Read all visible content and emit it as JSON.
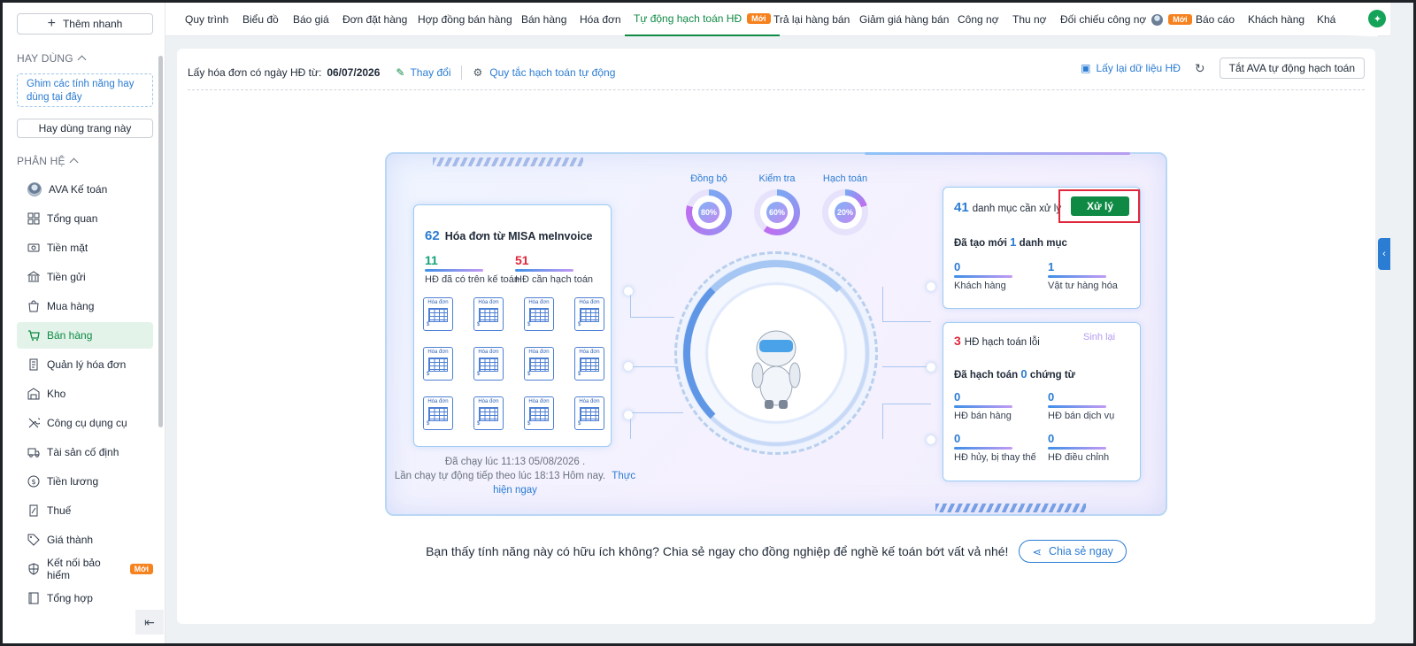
{
  "sidebar": {
    "quick_add": "Thêm nhanh",
    "frequent_title": "HAY DÙNG",
    "pin_hint": "Ghim các tính năng hay dùng tại đây",
    "use_page_button": "Hay dùng trang này",
    "modules_title": "PHÂN HỆ",
    "new_badge": "Mới",
    "items": [
      {
        "label": "AVA Kế toán",
        "icon": "avatar-icon"
      },
      {
        "label": "Tổng quan",
        "icon": "dashboard-icon"
      },
      {
        "label": "Tiền mặt",
        "icon": "cash-icon"
      },
      {
        "label": "Tiền gửi",
        "icon": "bank-icon"
      },
      {
        "label": "Mua hàng",
        "icon": "shopping-bag-icon"
      },
      {
        "label": "Bán hàng",
        "icon": "cart-icon"
      },
      {
        "label": "Quản lý hóa đơn",
        "icon": "invoice-icon"
      },
      {
        "label": "Kho",
        "icon": "warehouse-icon"
      },
      {
        "label": "Công cụ dụng cụ",
        "icon": "tools-icon"
      },
      {
        "label": "Tài sản cố định",
        "icon": "truck-icon"
      },
      {
        "label": "Tiền lương",
        "icon": "dollar-icon"
      },
      {
        "label": "Thuế",
        "icon": "tax-icon"
      },
      {
        "label": "Giá thành",
        "icon": "tag-icon"
      },
      {
        "label": "Kết nối bảo hiểm",
        "icon": "shield-icon"
      },
      {
        "label": "Tổng hợp",
        "icon": "book-icon"
      }
    ]
  },
  "topnav": {
    "tabs": [
      "Quy trình",
      "Biểu đồ",
      "Báo giá",
      "Đơn đặt hàng",
      "Hợp đồng bán hàng",
      "Bán hàng",
      "Hóa đơn",
      "Tự động hạch toán HĐ",
      "Trả lại hàng bán",
      "Giảm giá hàng bán",
      "Công nợ",
      "Thu nợ",
      "Đối chiếu công nợ",
      "Báo cáo",
      "Khách hàng",
      "Khá"
    ],
    "new_badge": "Mới"
  },
  "toolbar": {
    "date_label": "Lấy hóa đơn có ngày HĐ từ:",
    "date_value": "06/07/2026",
    "change": "Thay đổi",
    "rules": "Quy tắc hạch toán tự động",
    "reload": "Lấy lại dữ liệu HĐ",
    "stop_ava": "Tắt AVA tự động hạch toán"
  },
  "hero": {
    "left": {
      "count": "62",
      "title": "Hóa đơn từ MISA meInvoice",
      "posted_count": "11",
      "posted_label": "HĐ đã có trên kế toán",
      "pending_count": "51",
      "pending_label": "HĐ cần hạch toán",
      "invoice_tile_label": "Hóa đơn"
    },
    "rings": [
      {
        "label": "Đồng bộ",
        "percent": "80%",
        "value": 80
      },
      {
        "label": "Kiểm tra",
        "percent": "60%",
        "value": 60
      },
      {
        "label": "Hạch toán",
        "percent": "20%",
        "value": 20
      }
    ],
    "status_line1": "Đã chạy lúc 11:13 05/08/2026 .",
    "status_line2": "Lần chạy tự động tiếp theo lúc 18:13 Hôm nay.",
    "run_now": "Thực hiện ngay",
    "right_top": {
      "count": "41",
      "label": "danh mục cần xử lý",
      "button": "Xử lý",
      "created_prefix": "Đã tạo mới",
      "created_count": "1",
      "created_suffix": "danh mục",
      "customer_count": "0",
      "customer_label": "Khách hàng",
      "goods_count": "1",
      "goods_label": "Vật tư hàng hóa"
    },
    "right_bottom": {
      "error_count": "3",
      "error_label": "HĐ hạch toán lỗi",
      "regenerate": "Sinh lại",
      "posted_prefix": "Đã hạch toán",
      "posted_count": "0",
      "posted_suffix": "chứng từ",
      "items": [
        {
          "count": "0",
          "label": "HĐ bán hàng"
        },
        {
          "count": "0",
          "label": "HĐ bán dịch vụ"
        },
        {
          "count": "0",
          "label": "HĐ hủy, bị thay thế"
        },
        {
          "count": "0",
          "label": "HĐ điều chỉnh"
        }
      ]
    }
  },
  "feedback": {
    "text": "Bạn thấy tính năng này có hữu ích không? Chia sẻ ngay cho đồng nghiệp để nghề kế toán bớt vất vả nhé!",
    "share": "Chia sẻ ngay"
  },
  "colors": {
    "brand_green": "#0f8a45",
    "link_blue": "#2b7cd3",
    "alert_red": "#e0263b",
    "badge_orange": "#f6821f"
  }
}
